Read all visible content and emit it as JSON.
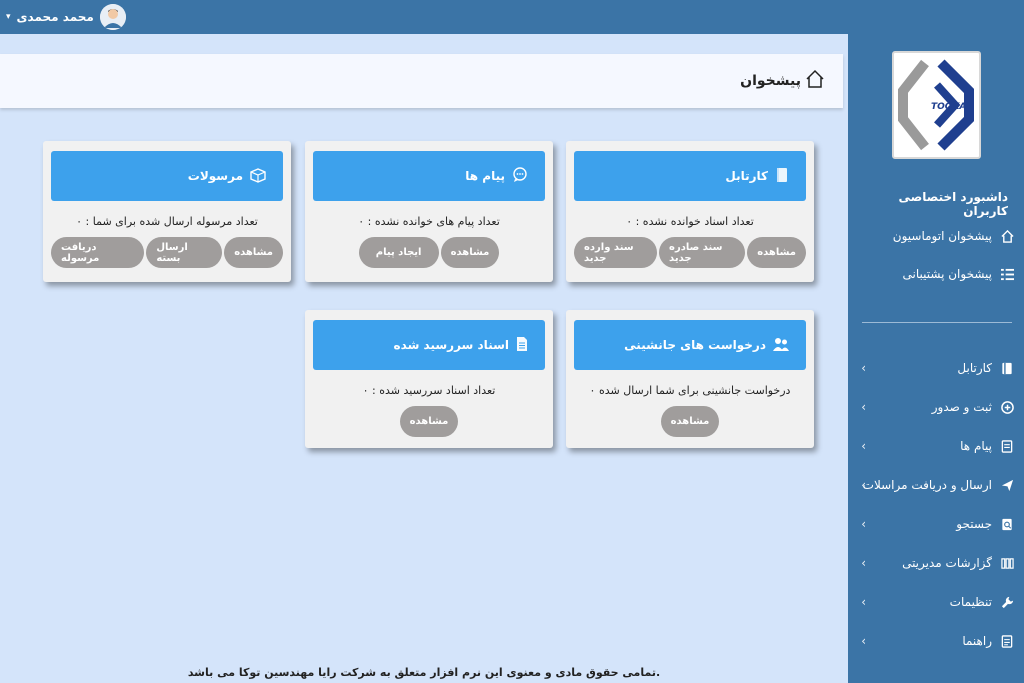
{
  "user": {
    "name": "محمد محمدی"
  },
  "page": {
    "title": "پیشخوان"
  },
  "sidebar": {
    "title": "داشبورد اختصاصی کاربران",
    "quick": [
      {
        "label": "پیشخوان اتوماسیون",
        "icon": "home-icon"
      },
      {
        "label": "پیشخوان پشتیبانی",
        "icon": "list-icon"
      }
    ],
    "menu": [
      {
        "label": "کارتابل",
        "icon": "folder-icon"
      },
      {
        "label": "ثبت و صدور",
        "icon": "plus-circle-icon"
      },
      {
        "label": "پیام ها",
        "icon": "message-icon"
      },
      {
        "label": "ارسال و دریافت مراسلات",
        "icon": "paper-plane-icon"
      },
      {
        "label": "جستجو",
        "icon": "search-icon"
      },
      {
        "label": "گزارشات مدیریتی",
        "icon": "report-icon"
      },
      {
        "label": "تنظیمات",
        "icon": "wrench-icon"
      },
      {
        "label": "راهنما",
        "icon": "help-icon"
      }
    ],
    "logo_text": "TOOKA"
  },
  "cards": {
    "cartable": {
      "title": "کارتابل",
      "text": "تعداد اسناد خوانده نشده : ۰",
      "buttons": [
        "مشاهده",
        "سند صادره جدید",
        "سند وارده جدید"
      ]
    },
    "messages": {
      "title": "پیام ها",
      "text": "تعداد پیام های خوانده نشده : ۰",
      "buttons": [
        "مشاهده",
        "ایجاد پیام"
      ]
    },
    "parcels": {
      "title": "مرسولات",
      "text": "تعداد مرسوله ارسال شده برای شما : ۰",
      "buttons": [
        "مشاهده",
        "ارسال بسته",
        "دریافت مرسوله"
      ]
    },
    "substitute": {
      "title": "درخواست های جانشینی",
      "text": "۰ درخواست جانشینی برای شما ارسال شده",
      "buttons": [
        "مشاهده"
      ]
    },
    "overdue": {
      "title": "اسناد سررسید شده",
      "text": "تعداد اسناد سررسید شده : ۰",
      "buttons": [
        "مشاهده"
      ]
    }
  },
  "footer": {
    "text": "تمامی حقوق مادی و معنوی این نرم افزار متعلق به شرکت رایا مهندسین توکا می باشد."
  }
}
